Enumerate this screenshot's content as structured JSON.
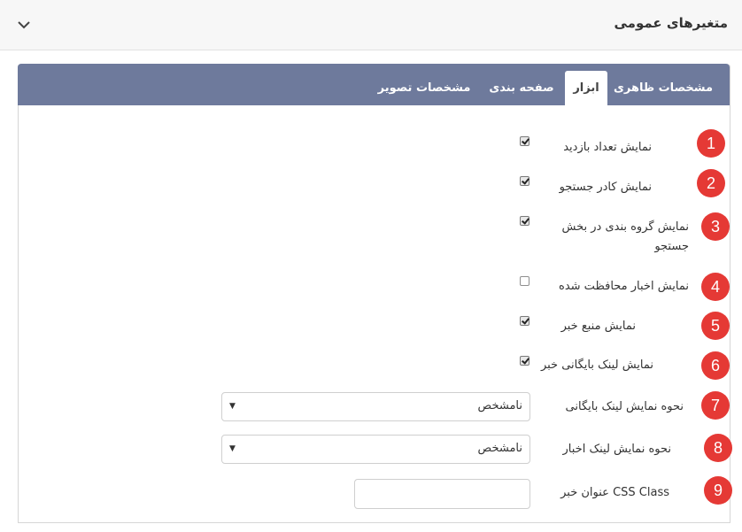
{
  "header": {
    "title": "متغیرهای عمومی",
    "toggle_icon": "chevron-down-icon"
  },
  "tabs": [
    {
      "label": "مشخصات ظاهری",
      "active": false
    },
    {
      "label": "ابزار",
      "active": true
    },
    {
      "label": "صفحه بندی",
      "active": false
    },
    {
      "label": "مشخصات تصویر",
      "active": false
    }
  ],
  "colors": {
    "tabbar": "#6e7a9c",
    "badge": "#e53935"
  },
  "fields": [
    {
      "num": "1",
      "label": "نمایش تعداد بازدید",
      "type": "checkbox",
      "checked": true
    },
    {
      "num": "2",
      "label": "نمایش کادر جستجو",
      "type": "checkbox",
      "checked": true
    },
    {
      "num": "3",
      "label": "نمایش گروه بندی در بخش جستجو",
      "type": "checkbox",
      "checked": true
    },
    {
      "num": "4",
      "label": "نمایش اخبار محافظت شده",
      "type": "checkbox",
      "checked": false
    },
    {
      "num": "5",
      "label": "نمایش منبع خبر",
      "type": "checkbox",
      "checked": true
    },
    {
      "num": "6",
      "label": "نمایش لینک بایگانی خبر",
      "type": "checkbox",
      "checked": true
    },
    {
      "num": "7",
      "label": "نحوه نمایش لینک بایگانی",
      "type": "select",
      "value": "نامشخص"
    },
    {
      "num": "8",
      "label": "نحوه نمایش لینک اخبار",
      "type": "select",
      "value": "نامشخص"
    },
    {
      "num": "9",
      "label": "CSS Class عنوان خبر",
      "type": "text",
      "value": ""
    }
  ]
}
